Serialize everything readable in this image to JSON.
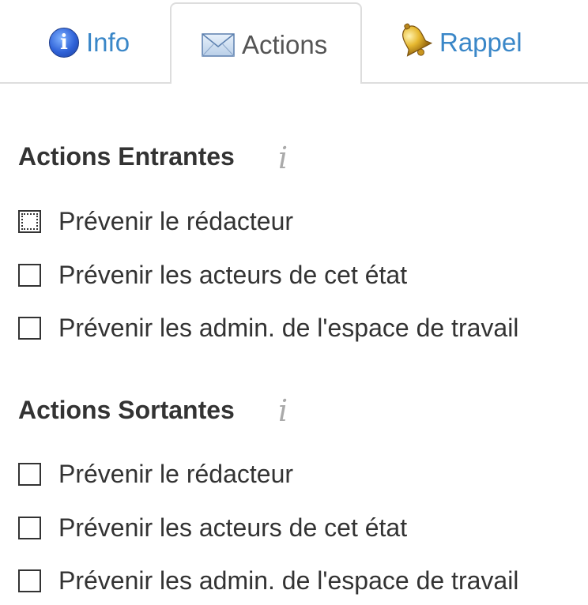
{
  "tabs": [
    {
      "label": "Info",
      "icon": "info-icon",
      "active": false
    },
    {
      "label": "Actions",
      "icon": "envelope-icon",
      "active": true
    },
    {
      "label": "Rappel",
      "icon": "bell-icon",
      "active": false
    }
  ],
  "sections": {
    "entrantes": {
      "title": "Actions Entrantes",
      "help_icon": "i",
      "options": [
        {
          "label": "Prévenir le rédacteur",
          "checked": false,
          "focused": true
        },
        {
          "label": "Prévenir les acteurs de cet état",
          "checked": false
        },
        {
          "label": "Prévenir les admin. de l'espace de travail",
          "checked": false
        }
      ]
    },
    "sortantes": {
      "title": "Actions Sortantes",
      "help_icon": "i",
      "options": [
        {
          "label": "Prévenir le rédacteur",
          "checked": false
        },
        {
          "label": "Prévenir les acteurs de cet état",
          "checked": false
        },
        {
          "label": "Prévenir les admin. de l'espace de travail",
          "checked": false
        }
      ]
    }
  },
  "colors": {
    "link": "#3a87c8",
    "active_tab_text": "#555555",
    "border": "#dddddd",
    "text": "#333333",
    "help_icon": "#aaaaaa"
  }
}
